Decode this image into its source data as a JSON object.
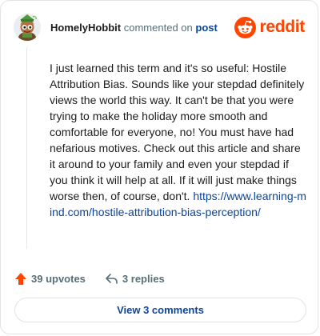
{
  "comment": {
    "username": "HomelyHobbit",
    "action_text": "commented on",
    "target_link": "post",
    "text": "I just learned this term and it's so useful: Hostile Attribution Bias. Sounds like your stepdad definitely views the world this way. It can't be that you were trying to make the holiday more smooth and comfortable for everyone, no! You must have had nefarious motives. Check out this article and share it around to your family and even your stepdad if you think it will help at all. If it will just make things worse then, of course, don't.",
    "link": "https://www.learning-mind.com/hostile-attribution-bias-perception/"
  },
  "brand": {
    "name": "reddit",
    "icon": "reddit-alien-icon",
    "color": "#ff4500"
  },
  "stats": {
    "upvotes": "39 upvotes",
    "replies": "3 replies",
    "upvote_icon": "upvote-arrow-icon",
    "reply_icon": "reply-arrow-icon",
    "upvote_color": "#ff4500"
  },
  "footer": {
    "view_comments": "View 3 comments"
  },
  "colors": {
    "link": "#0a449b",
    "muted": "#576f76",
    "text": "#1c1c1c",
    "border": "#e1e3e6"
  }
}
